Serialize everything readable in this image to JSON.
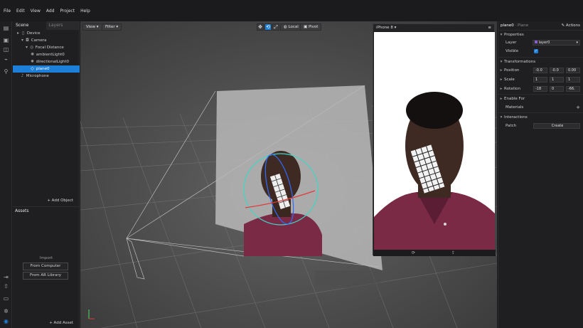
{
  "menu": [
    "File",
    "Edit",
    "View",
    "Add",
    "Project",
    "Help"
  ],
  "scene": {
    "tabs": [
      "Scene",
      "Layers"
    ],
    "tree": [
      {
        "label": "Device",
        "icon": "device-icon",
        "selected": false
      },
      {
        "label": "Camera",
        "icon": "camera-icon",
        "selected": false
      },
      {
        "label": "Focal Distance",
        "icon": "focal-distance-icon",
        "selected": false
      },
      {
        "label": "ambientLight0",
        "icon": "ambient-light-icon",
        "selected": false
      },
      {
        "label": "directionalLight0",
        "icon": "directional-light-icon",
        "selected": false
      },
      {
        "label": "plane0",
        "icon": "plane-icon",
        "selected": true
      },
      {
        "label": "Microphone",
        "icon": "microphone-icon",
        "selected": false
      }
    ],
    "add_object": "+ Add Object"
  },
  "assets": {
    "title": "Assets",
    "import_label": "Import",
    "from_computer": "From Computer",
    "from_library": "From AR Library",
    "add_asset": "+ Add Asset"
  },
  "viewport": {
    "view_label": "View",
    "filter_label": "Filter",
    "local_label": "Local",
    "pivot_label": "Pivot"
  },
  "phone": {
    "device": "iPhone 8"
  },
  "inspector": {
    "title": "plane0",
    "subtitle": "· Plane",
    "actions": "Actions",
    "properties": "Properties",
    "layer_label": "Layer",
    "layer_value": "layer0",
    "visible_label": "Visible",
    "transformations": "Transformations",
    "position_label": "Position",
    "position": [
      "-0.0",
      "-0.0",
      "0.00"
    ],
    "scale_label": "Scale",
    "scale": [
      "1",
      "1",
      "1"
    ],
    "rotation_label": "Rotation",
    "rotation": [
      "-18",
      "0",
      "-66."
    ],
    "enable_for": "Enable For",
    "materials": "Materials",
    "interactions": "Interactions",
    "patch_label": "Patch",
    "create_label": "Create"
  },
  "colors": {
    "accent": "#1e7fd8",
    "panel": "#1f1f21",
    "viewport": "#575757",
    "shirt": "#7a2a45"
  }
}
